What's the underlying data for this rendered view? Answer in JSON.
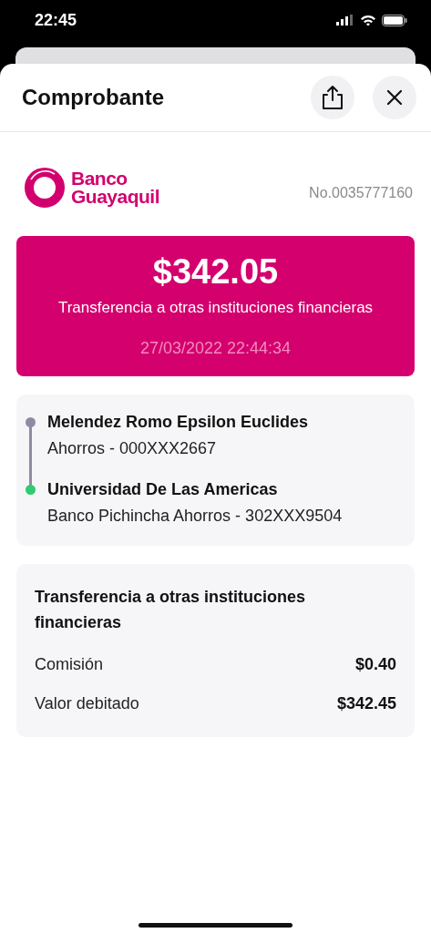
{
  "status_bar": {
    "time": "22:45"
  },
  "header": {
    "title": "Comprobante"
  },
  "bank": {
    "name_line_1": "Banco",
    "name_line_2": "Guayaquil",
    "receipt_number": "No.0035777160"
  },
  "amount_card": {
    "amount": "$342.05",
    "description": "Transferencia a otras instituciones financieras",
    "datetime": "27/03/2022 22:44:34"
  },
  "parties": [
    {
      "name": "Melendez Romo Epsilon Euclides",
      "account": "Ahorros - 000XXX2667",
      "color": "#8e8ca3"
    },
    {
      "name": "Universidad De Las Americas",
      "account": "Banco Pichincha Ahorros - 302XXX9504",
      "color": "#2ecc71"
    }
  ],
  "summary": {
    "title": "Transferencia a otras instituciones financieras",
    "rows": [
      {
        "label": "Comisión",
        "value": "$0.40"
      },
      {
        "label": "Valor debitado",
        "value": "$342.45"
      }
    ]
  }
}
